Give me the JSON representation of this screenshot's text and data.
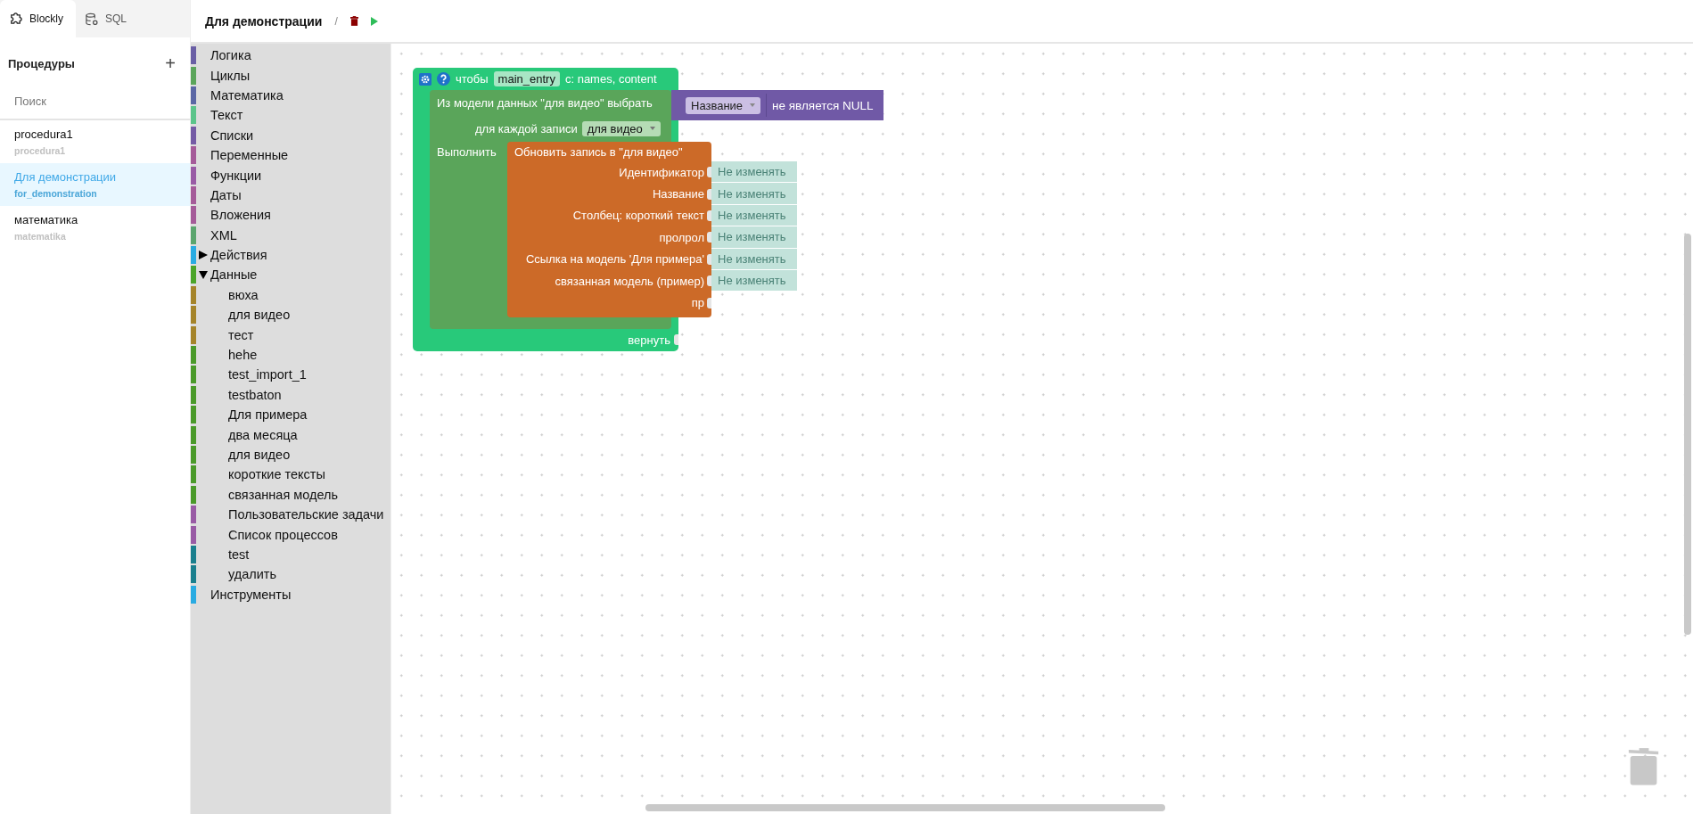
{
  "tabs": [
    {
      "label": "Blockly",
      "selected": true
    },
    {
      "label": "SQL",
      "selected": false
    }
  ],
  "procedures": {
    "title": "Процедуры",
    "add": "+",
    "search": {
      "placeholder": "Поиск"
    },
    "items": [
      {
        "name": "procedura1",
        "code": "procedura1",
        "selected": false
      },
      {
        "name": "Для демонстрации",
        "code": "for_demonstration",
        "selected": true
      },
      {
        "name": "математика",
        "code": "matematika",
        "selected": false
      }
    ]
  },
  "header": {
    "title": "Для демонстрации",
    "separator": "/"
  },
  "toolbox": {
    "categories": [
      {
        "label": "Логика",
        "color": "#6a5fa5"
      },
      {
        "label": "Циклы",
        "color": "#5ba55b"
      },
      {
        "label": "Математика",
        "color": "#5b67a5"
      },
      {
        "label": "Текст",
        "color": "#5bc48a"
      },
      {
        "label": "Списки",
        "color": "#745ba5"
      },
      {
        "label": "Переменные",
        "color": "#a55b99"
      },
      {
        "label": "Функции",
        "color": "#995ba5"
      },
      {
        "label": "Даты",
        "color": "#a55b99"
      },
      {
        "label": "Вложения",
        "color": "#a55b99"
      },
      {
        "label": "XML",
        "color": "#5ba56e"
      },
      {
        "label": "Действия",
        "color": "#29abe2",
        "expanded": false
      },
      {
        "label": "Данные",
        "color": "#4ba52a",
        "expanded": true,
        "children": [
          {
            "label": "вюха",
            "color": "#a5842a"
          },
          {
            "label": "для видео",
            "color": "#a5842a"
          },
          {
            "label": "тест",
            "color": "#a5842a"
          },
          {
            "label": "hehe",
            "color": "#4a9a2a"
          },
          {
            "label": "test_import_1",
            "color": "#4a9a2a"
          },
          {
            "label": "testbaton",
            "color": "#4a9a2a"
          },
          {
            "label": "Для примера",
            "color": "#4a9a2a"
          },
          {
            "label": "два месяца",
            "color": "#4a9a2a"
          },
          {
            "label": "для видео",
            "color": "#4a9a2a"
          },
          {
            "label": "короткие тексты",
            "color": "#4a9a2a"
          },
          {
            "label": "связанная модель",
            "color": "#4a9a2a"
          },
          {
            "label": "Пользовательские задачи",
            "color": "#995ba5"
          },
          {
            "label": "Список процессов",
            "color": "#995ba5"
          },
          {
            "label": "test",
            "color": "#1a7f8e"
          },
          {
            "label": "удалить",
            "color": "#1a7f8e"
          }
        ]
      },
      {
        "label": "Инструменты",
        "color": "#29abe2"
      }
    ]
  },
  "workspace": {
    "procedure_block": {
      "label": "чтобы",
      "name": "main_entry",
      "params": "с: names, content",
      "return_label": "вернуть",
      "select_block": {
        "label": "Из модели данных \"для видео\" выбрать",
        "for_each_label": "для каждой записи",
        "for_each_value": "для видео",
        "do_label": "Выполнить",
        "condition": {
          "field": "Название",
          "text": "не является NULL"
        },
        "update_block": {
          "title": "Обновить запись в \"для видео\"",
          "fields": [
            {
              "label": "Идентификатор",
              "value": "Не изменять"
            },
            {
              "label": "Название",
              "value": "Не изменять"
            },
            {
              "label": "Столбец: короткий текст",
              "value": "Не изменять"
            },
            {
              "label": "пролрол",
              "value": "Не изменять"
            },
            {
              "label": "Ссылка на модель 'Для примера'",
              "value": "Не изменять"
            },
            {
              "label": "связанная модель (пример)",
              "value": "Не изменять"
            },
            {
              "label": "пр"
            }
          ]
        }
      }
    }
  }
}
